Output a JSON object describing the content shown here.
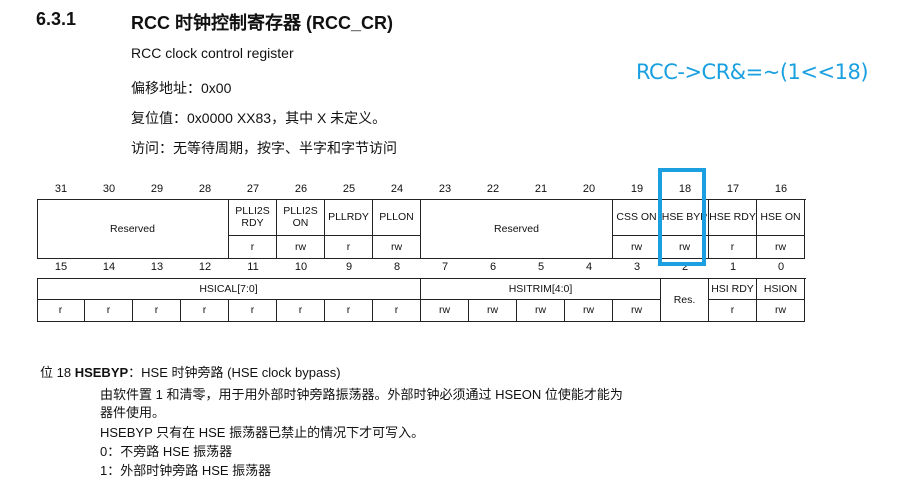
{
  "section": {
    "number": "6.3.1",
    "title": "RCC 时钟控制寄存器 (RCC_CR)"
  },
  "meta": {
    "subtitle": "RCC clock control register",
    "offset": "偏移地址：0x00",
    "reset": "复位值：0x0000 XX83，其中 X 未定义。",
    "access": "访问：无等待周期，按字、半字和字节访问"
  },
  "annotation": "RCC->CR&=~(1<<18)",
  "highlight_color": "#1aa0e0",
  "register": {
    "high_fields": [
      {
        "name": "Reserved",
        "bits": [
          31,
          28
        ],
        "access": null
      },
      {
        "name": "PLLI2S RDY",
        "bits": [
          27,
          27
        ],
        "access": [
          "r"
        ]
      },
      {
        "name": "PLLI2S ON",
        "bits": [
          26,
          26
        ],
        "access": [
          "rw"
        ]
      },
      {
        "name": "PLLRDY",
        "bits": [
          25,
          25
        ],
        "access": [
          "r"
        ]
      },
      {
        "name": "PLLON",
        "bits": [
          24,
          24
        ],
        "access": [
          "rw"
        ]
      },
      {
        "name": "Reserved",
        "bits": [
          23,
          20
        ],
        "access": null
      },
      {
        "name": "CSS ON",
        "bits": [
          19,
          19
        ],
        "access": [
          "rw"
        ]
      },
      {
        "name": "HSE BYP",
        "bits": [
          18,
          18
        ],
        "access": [
          "rw"
        ]
      },
      {
        "name": "HSE RDY",
        "bits": [
          17,
          17
        ],
        "access": [
          "r"
        ]
      },
      {
        "name": "HSE ON",
        "bits": [
          16,
          16
        ],
        "access": [
          "rw"
        ]
      }
    ],
    "low_fields": [
      {
        "name": "HSICAL[7:0]",
        "bits": [
          15,
          8
        ],
        "access": [
          "r",
          "r",
          "r",
          "r",
          "r",
          "r",
          "r",
          "r"
        ]
      },
      {
        "name": "HSITRIM[4:0]",
        "bits": [
          7,
          3
        ],
        "access": [
          "rw",
          "rw",
          "rw",
          "rw",
          "rw"
        ]
      },
      {
        "name": "Res.",
        "bits": [
          2,
          2
        ],
        "access": null
      },
      {
        "name": "HSI RDY",
        "bits": [
          1,
          1
        ],
        "access": [
          "r"
        ]
      },
      {
        "name": "HSION",
        "bits": [
          0,
          0
        ],
        "access": [
          "rw"
        ]
      }
    ]
  },
  "description": {
    "heading_prefix": "位 18",
    "heading_name": "HSEBYP",
    "heading_rest": "：HSE 时钟旁路 (HSE clock bypass)",
    "lines": [
      "由软件置 1 和清零，用于用外部时钟旁路振荡器。外部时钟必须通过 HSEON 位使能才能为",
      "器件使用。",
      "HSEBYP 只有在 HSE 振荡器已禁止的情况下才可写入。",
      "0：不旁路 HSE 振荡器",
      "1：外部时钟旁路 HSE 振荡器"
    ]
  }
}
